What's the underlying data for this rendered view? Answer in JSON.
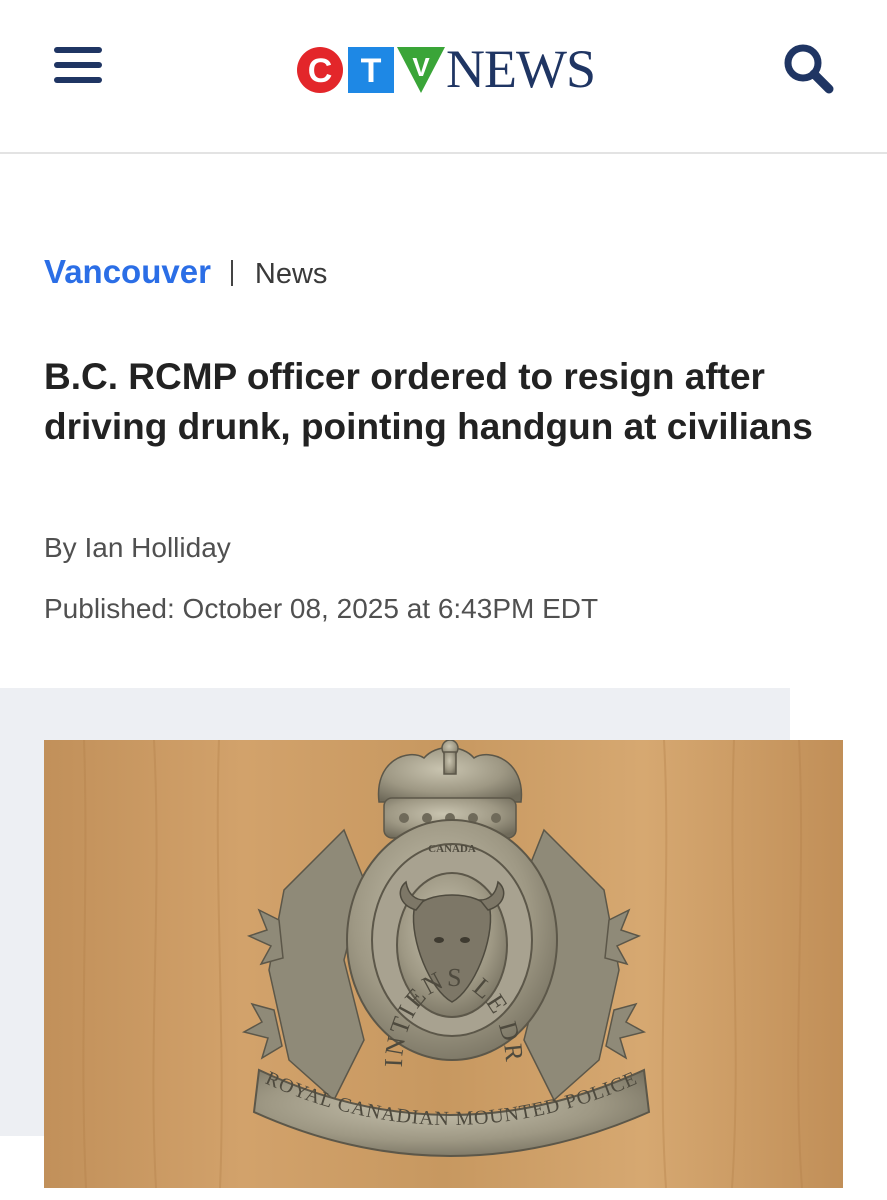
{
  "header": {
    "logo": {
      "brand_letters": [
        "C",
        "T",
        "V"
      ],
      "news_text": "NEWS"
    },
    "menu_icon": "hamburger-icon",
    "search_icon": "search-icon"
  },
  "breadcrumb": {
    "region": "Vancouver",
    "section": "News"
  },
  "article": {
    "headline": "B.C. RCMP officer ordered to resign after driving drunk, pointing handgun at civilians",
    "byline_prefix": "By",
    "author": "Ian Holliday",
    "published": "Published: October 08, 2025 at 6:43PM EDT"
  },
  "image": {
    "badge_text": {
      "top": "CANADA",
      "motto": "MAINTIENS LE DROIT",
      "scroll": "ROYAL CANADIAN MOUNTED POLICE"
    }
  },
  "colors": {
    "navy": "#1f3563",
    "link_blue": "#2b6ee6",
    "ctv_red": "#e3262a",
    "ctv_blue": "#1e88e5",
    "ctv_green": "#3aa538",
    "wood": "#c99a62",
    "band_gray": "#edeff3"
  }
}
